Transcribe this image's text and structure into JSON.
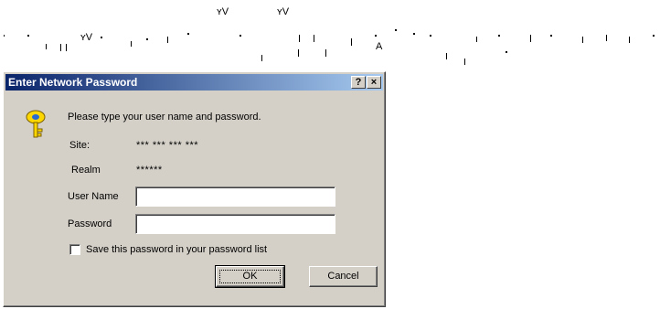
{
  "top_fragments": {
    "glyph_a": "ʏV",
    "glyph_b": "ʏV",
    "glyph_c": "ʏV",
    "glyph_d": "A"
  },
  "dialog": {
    "title": "Enter Network Password",
    "help_button": "?",
    "close_button": "×",
    "key_icon": "key-icon",
    "prompt": "Please type your user name and password.",
    "site_label": "Site:",
    "site_value": "*** *** *** ***",
    "realm_label": "Realm",
    "realm_value": "******",
    "user_name_label": "User Name",
    "user_name_value": "",
    "password_label": "Password",
    "password_value": "",
    "save_password_label": "Save this password in your password list",
    "save_password_checked": false,
    "ok_label": "OK",
    "cancel_label": "Cancel"
  },
  "colors": {
    "dialog_face": "#d4d0c8",
    "title_start": "#0a246a",
    "title_end": "#a6caf0"
  }
}
